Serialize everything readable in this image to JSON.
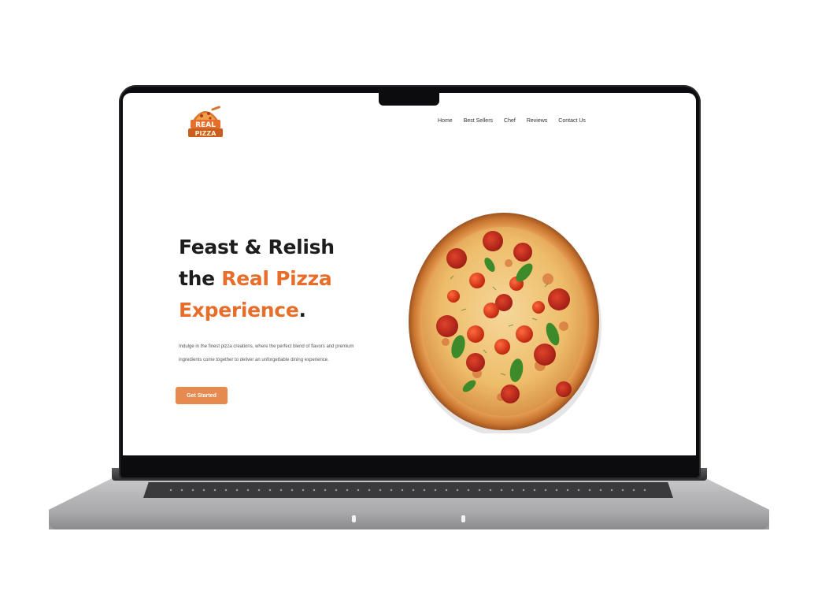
{
  "site": {
    "logo_text_line1": "REAL",
    "logo_text_line2": "PIZZA"
  },
  "nav": {
    "items": [
      {
        "label": "Home"
      },
      {
        "label": "Best Sellers"
      },
      {
        "label": "Chef"
      },
      {
        "label": "Reviews"
      },
      {
        "label": "Contact Us"
      }
    ]
  },
  "hero": {
    "line1": "Feast & Relish",
    "line2_prefix": "the ",
    "line2_accent": "Real Pizza",
    "line3_accent": "Experience",
    "line3_suffix": "."
  },
  "description": "Indulge in the finest pizza creations, where the perfect blend of flavors and premium ingredients come together to deliver an unforgettable dining experience.",
  "cta": {
    "label": "Get Started"
  },
  "colors": {
    "accent": "#e76d2a",
    "button": "#e78a4f",
    "heading": "#1d1d1d"
  },
  "icons": {
    "logo": "pizza-logo-icon",
    "hero_image": "pizza-image"
  }
}
